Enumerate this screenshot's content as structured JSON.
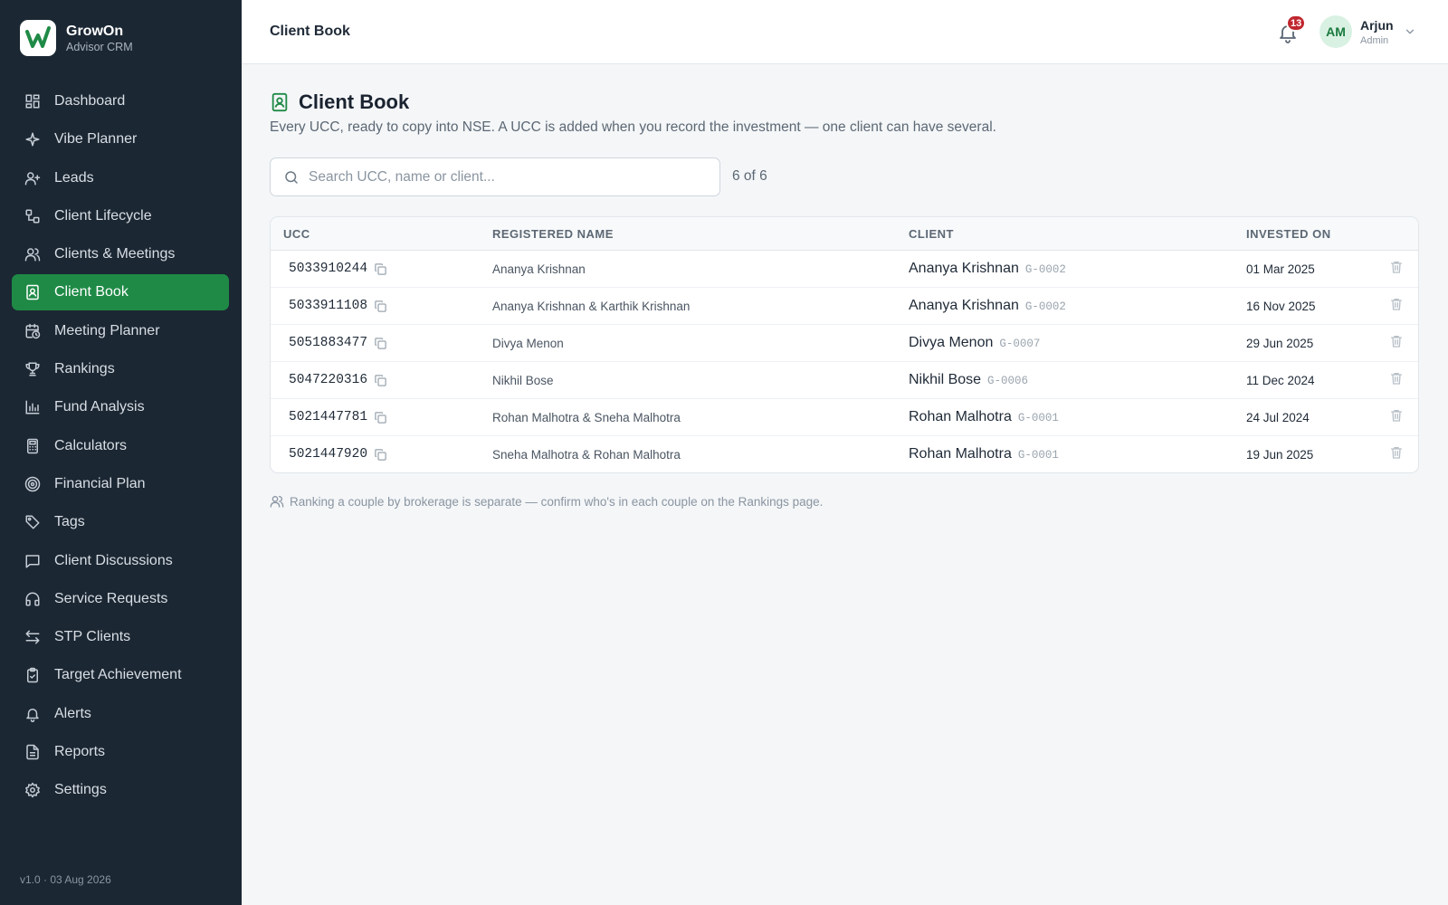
{
  "brand": {
    "name": "GrowOn",
    "subtitle": "Advisor CRM"
  },
  "nav": [
    {
      "label": "Dashboard",
      "icon": "dashboard-icon"
    },
    {
      "label": "Vibe Planner",
      "icon": "sparkle-icon"
    },
    {
      "label": "Leads",
      "icon": "user-plus-icon"
    },
    {
      "label": "Client Lifecycle",
      "icon": "lifecycle-icon"
    },
    {
      "label": "Clients & Meetings",
      "icon": "users-icon"
    },
    {
      "label": "Client Book",
      "icon": "contact-book-icon",
      "active": true
    },
    {
      "label": "Meeting Planner",
      "icon": "calendar-clock-icon"
    },
    {
      "label": "Rankings",
      "icon": "trophy-icon"
    },
    {
      "label": "Fund Analysis",
      "icon": "bar-chart-icon"
    },
    {
      "label": "Calculators",
      "icon": "calculator-icon"
    },
    {
      "label": "Financial Plan",
      "icon": "target-icon"
    },
    {
      "label": "Tags",
      "icon": "tag-icon"
    },
    {
      "label": "Client Discussions",
      "icon": "message-icon"
    },
    {
      "label": "Service Requests",
      "icon": "headphones-icon"
    },
    {
      "label": "STP Clients",
      "icon": "arrows-icon"
    },
    {
      "label": "Target Achievement",
      "icon": "clipboard-check-icon"
    },
    {
      "label": "Alerts",
      "icon": "bell-icon"
    },
    {
      "label": "Reports",
      "icon": "file-text-icon"
    },
    {
      "label": "Settings",
      "icon": "gear-icon"
    }
  ],
  "version": "v1.0 · 03 Aug 2026",
  "topbar": {
    "title": "Client Book",
    "notifications": "13",
    "user": {
      "initials": "AM",
      "name": "Arjun",
      "role": "Admin"
    }
  },
  "page": {
    "title": "Client Book",
    "description": "Every UCC, ready to copy into NSE. A UCC is added when you record the investment — one client can have several."
  },
  "search": {
    "placeholder": "Search UCC, name or client...",
    "value": "",
    "count": "6 of 6"
  },
  "table": {
    "headers": {
      "ucc": "UCC",
      "registered": "REGISTERED NAME",
      "client": "CLIENT",
      "invested": "INVESTED ON"
    },
    "rows": [
      {
        "ucc": "5033910244",
        "registered": "Ananya Krishnan",
        "client": "Ananya Krishnan",
        "code": "G-0002",
        "date": "01 Mar 2025"
      },
      {
        "ucc": "5033911108",
        "registered": "Ananya Krishnan & Karthik Krishnan",
        "client": "Ananya Krishnan",
        "code": "G-0002",
        "date": "16 Nov 2025"
      },
      {
        "ucc": "5051883477",
        "registered": "Divya Menon",
        "client": "Divya Menon",
        "code": "G-0007",
        "date": "29 Jun 2025"
      },
      {
        "ucc": "5047220316",
        "registered": "Nikhil Bose",
        "client": "Nikhil Bose",
        "code": "G-0006",
        "date": "11 Dec 2024"
      },
      {
        "ucc": "5021447781",
        "registered": "Rohan Malhotra & Sneha Malhotra",
        "client": "Rohan Malhotra",
        "code": "G-0001",
        "date": "24 Jul 2024"
      },
      {
        "ucc": "5021447920",
        "registered": "Sneha Malhotra & Rohan Malhotra",
        "client": "Rohan Malhotra",
        "code": "G-0001",
        "date": "19 Jun 2025"
      }
    ]
  },
  "footnote": "Ranking a couple by brokerage is separate — confirm who's in each couple on the Rankings page.",
  "colors": {
    "sidebar": "#1b2733",
    "accent": "#1f8a46",
    "badge": "#c0262d"
  }
}
